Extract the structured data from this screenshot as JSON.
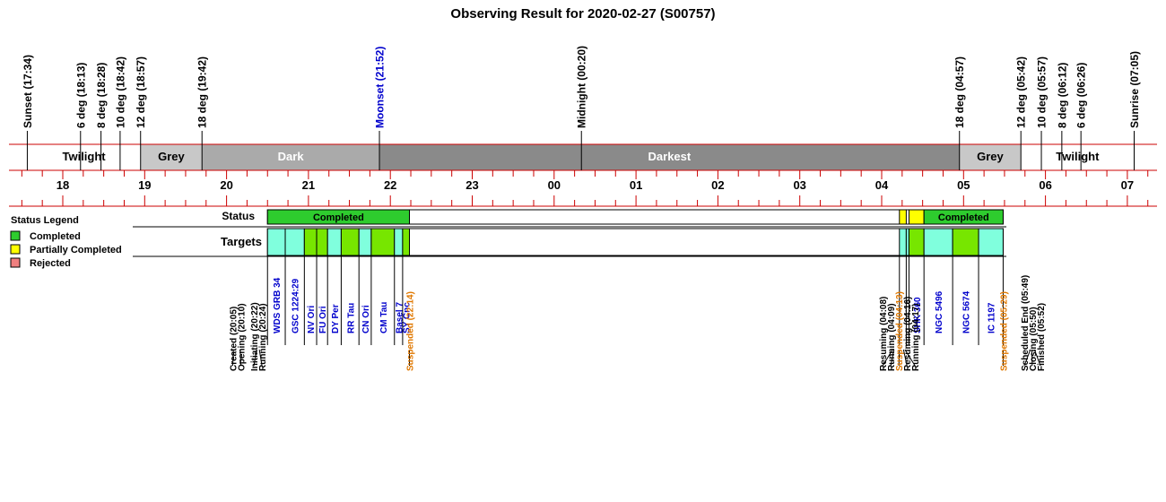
{
  "title": "Observing Result for 2020-02-27 (S00757)",
  "colors": {
    "twilight": "#ffffff",
    "grey": "#c8c8c8",
    "dark": "#aaaaaa",
    "darkest": "#8a8a8a",
    "axis_red": "#cc0000",
    "completed": "#2ecc2e",
    "partial": "#ffff00",
    "rejected": "#f08080",
    "target_cyan": "#80ffdd",
    "target_green": "#77e600",
    "target_text": "#0000cc",
    "moonset": "#0000cc",
    "suspended": "#e07800",
    "event_text": "#000000"
  },
  "chart_data": {
    "type": "timeline",
    "title": "Observing Result for 2020-02-27 (S00757)",
    "hour_ticks": [
      "18",
      "19",
      "20",
      "21",
      "22",
      "23",
      "00",
      "01",
      "02",
      "03",
      "04",
      "05",
      "06",
      "07"
    ],
    "sky_events": [
      {
        "label": "Sunset (17:34)",
        "time": "17:34",
        "color": "black"
      },
      {
        "label": "6 deg (18:13)",
        "time": "18:13",
        "color": "black"
      },
      {
        "label": "8 deg (18:28)",
        "time": "18:28",
        "color": "black"
      },
      {
        "label": "10 deg (18:42)",
        "time": "18:42",
        "color": "black"
      },
      {
        "label": "12 deg (18:57)",
        "time": "18:57",
        "color": "black"
      },
      {
        "label": "18 deg (19:42)",
        "time": "19:42",
        "color": "black"
      },
      {
        "label": "Moonset (21:52)",
        "time": "21:52",
        "color": "blue"
      },
      {
        "label": "Midnight (00:20)",
        "time": "00:20",
        "color": "black"
      },
      {
        "label": "18 deg (04:57)",
        "time": "04:57",
        "color": "black"
      },
      {
        "label": "12 deg (05:42)",
        "time": "05:42",
        "color": "black"
      },
      {
        "label": "10 deg (05:57)",
        "time": "05:57",
        "color": "black"
      },
      {
        "label": "8 deg (06:12)",
        "time": "06:12",
        "color": "black"
      },
      {
        "label": "6 deg (06:26)",
        "time": "06:26",
        "color": "black"
      },
      {
        "label": "Sunrise (07:05)",
        "time": "07:05",
        "color": "black"
      }
    ],
    "bands": [
      {
        "label": "Twilight",
        "start": "17:34",
        "end": "18:57",
        "shade": "twilight"
      },
      {
        "label": "Grey",
        "start": "18:57",
        "end": "19:42",
        "shade": "grey"
      },
      {
        "label": "Dark",
        "start": "19:42",
        "end": "21:52",
        "shade": "dark"
      },
      {
        "label": "Darkest",
        "start": "21:52",
        "end": "04:57",
        "shade": "darkest"
      },
      {
        "label": "Grey",
        "start": "04:57",
        "end": "05:42",
        "shade": "grey"
      },
      {
        "label": "Twilight",
        "start": "05:42",
        "end": "07:05",
        "shade": "twilight"
      }
    ],
    "status_row_label": "Status",
    "targets_row_label": "Targets",
    "status_segments": [
      {
        "start": "20:30",
        "end": "22:14",
        "status": "completed",
        "label": "Completed"
      },
      {
        "start": "04:13",
        "end": "04:18",
        "status": "partial",
        "label": ""
      },
      {
        "start": "04:20",
        "end": "04:31",
        "status": "partial",
        "label": ""
      },
      {
        "start": "04:31",
        "end": "05:29",
        "status": "completed",
        "label": "Completed"
      }
    ],
    "targets": [
      {
        "name": "WDS GRB 34",
        "start": "20:30",
        "end": "20:43",
        "color": "cyan"
      },
      {
        "name": "GSC 1224:29",
        "start": "20:43",
        "end": "20:57",
        "color": "cyan"
      },
      {
        "name": "NV Ori",
        "start": "20:57",
        "end": "21:06",
        "color": "green"
      },
      {
        "name": "FU Ori",
        "start": "21:06",
        "end": "21:14",
        "color": "green"
      },
      {
        "name": "DY Per",
        "start": "21:14",
        "end": "21:24",
        "color": "cyan"
      },
      {
        "name": "RR Tau",
        "start": "21:24",
        "end": "21:37",
        "color": "green"
      },
      {
        "name": "CN Ori",
        "start": "21:37",
        "end": "21:46",
        "color": "cyan"
      },
      {
        "name": "CM Tau",
        "start": "21:46",
        "end": "22:03",
        "color": "green"
      },
      {
        "name": "Basel 7",
        "start": "22:03",
        "end": "22:09",
        "color": "cyan"
      },
      {
        "name": "SY Cnc",
        "start": "22:09",
        "end": "22:14",
        "color": "green"
      },
      {
        "name": "",
        "start": "04:13",
        "end": "04:18",
        "color": "cyan"
      },
      {
        "name": "",
        "start": "04:18",
        "end": "04:20",
        "color": "cyan"
      },
      {
        "name": "SHK 360",
        "start": "04:20",
        "end": "04:31",
        "color": "green"
      },
      {
        "name": "NGC 5496",
        "start": "04:31",
        "end": "04:52",
        "color": "cyan"
      },
      {
        "name": "NGC 5674",
        "start": "04:52",
        "end": "05:11",
        "color": "green"
      },
      {
        "name": "IC 1197",
        "start": "05:11",
        "end": "05:29",
        "color": "cyan"
      }
    ],
    "events": [
      {
        "label": "Created (20:05)",
        "time": "20:05",
        "color": "black"
      },
      {
        "label": "Opening (20:10)",
        "time": "20:10",
        "color": "black"
      },
      {
        "label": "Initiating (20:22)",
        "time": "20:22",
        "color": "black"
      },
      {
        "label": "Running (20:24)",
        "time": "20:24",
        "color": "black"
      },
      {
        "label": "Suspended (22:14)",
        "time": "22:14",
        "color": "orange"
      },
      {
        "label": "Resuming (04:08)",
        "time": "04:08",
        "color": "black"
      },
      {
        "label": "Running (04:09)",
        "time": "04:09",
        "color": "black"
      },
      {
        "label": "Suspended (04:13)",
        "time": "04:13",
        "color": "orange"
      },
      {
        "label": "Resuming (04:16)",
        "time": "04:16",
        "color": "black"
      },
      {
        "label": "Running (04:17)",
        "time": "04:17",
        "color": "black"
      },
      {
        "label": "Suspended (05:29)",
        "time": "05:29",
        "color": "orange"
      },
      {
        "label": "Scheduled End (05:49)",
        "time": "05:49",
        "color": "black"
      },
      {
        "label": "Closing (05:50)",
        "time": "05:50",
        "color": "black"
      },
      {
        "label": "Finished (05:52)",
        "time": "05:52",
        "color": "black"
      }
    ],
    "legend": {
      "title": "Status Legend",
      "placement": "left",
      "items": [
        {
          "label": "Completed",
          "status": "completed"
        },
        {
          "label": "Partially Completed",
          "status": "partial"
        },
        {
          "label": "Rejected",
          "status": "rejected"
        }
      ]
    }
  }
}
